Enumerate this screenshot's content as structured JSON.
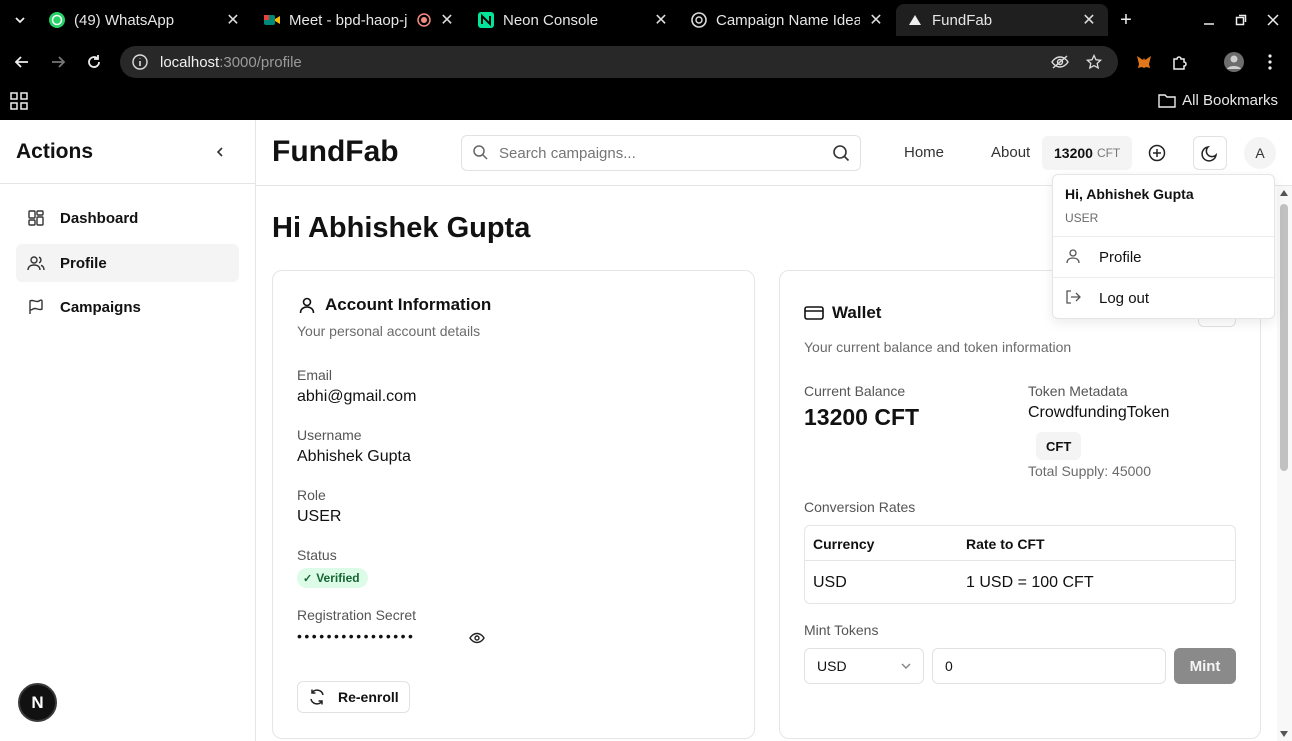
{
  "browser": {
    "tabs": [
      {
        "title": "(49) WhatsApp",
        "icon": "whatsapp-icon"
      },
      {
        "title": "Meet - bpd-haop-j",
        "icon": "google-meet-icon"
      },
      {
        "title": "Neon Console",
        "icon": "neon-icon"
      },
      {
        "title": "Campaign Name Idea",
        "icon": "chatgpt-icon"
      },
      {
        "title": "FundFab",
        "icon": "vercel-icon"
      }
    ],
    "url_host": "localhost",
    "url_path": ":3000/profile",
    "bookmarks_label": "All Bookmarks"
  },
  "sidebar": {
    "title": "Actions",
    "items": [
      {
        "label": "Dashboard",
        "icon": "dashboard-icon"
      },
      {
        "label": "Profile",
        "icon": "users-icon"
      },
      {
        "label": "Campaigns",
        "icon": "flag-icon"
      }
    ]
  },
  "header": {
    "brand": "FundFab",
    "search_placeholder": "Search campaigns...",
    "nav": [
      "Home",
      "About"
    ],
    "balance": "13200",
    "balance_unit": "CFT",
    "avatar_initial": "A"
  },
  "main": {
    "greeting": "Hi Abhishek Gupta",
    "account": {
      "title": "Account Information",
      "subtitle": "Your personal account details",
      "email_label": "Email",
      "email": "abhi@gmail.com",
      "username_label": "Username",
      "username": "Abhishek Gupta",
      "role_label": "Role",
      "role": "USER",
      "status_label": "Status",
      "status": "Verified",
      "secret_label": "Registration Secret",
      "secret": "••••••••••••••••",
      "reenroll": "Re-enroll"
    },
    "wallet": {
      "title": "Wallet",
      "subtitle": "Your current balance and token information",
      "balance_label": "Current Balance",
      "balance": "13200 CFT",
      "metadata_label": "Token Metadata",
      "token_name": "CrowdfundingToken",
      "token_symbol": "CFT",
      "total_supply": "Total Supply: 45000",
      "conversion_label": "Conversion Rates",
      "table_headers": [
        "Currency",
        "Rate to CFT"
      ],
      "table_rows": [
        [
          "USD",
          "1 USD = 100 CFT"
        ]
      ],
      "mint_label": "Mint Tokens",
      "mint_currency": "USD",
      "mint_amount": "0",
      "mint_button": "Mint"
    }
  },
  "dropdown": {
    "greeting": "Hi, Abhishek Gupta",
    "role": "USER",
    "items": [
      {
        "label": "Profile",
        "icon": "user-icon"
      },
      {
        "label": "Log out",
        "icon": "logout-icon"
      }
    ]
  },
  "next_badge": "N"
}
